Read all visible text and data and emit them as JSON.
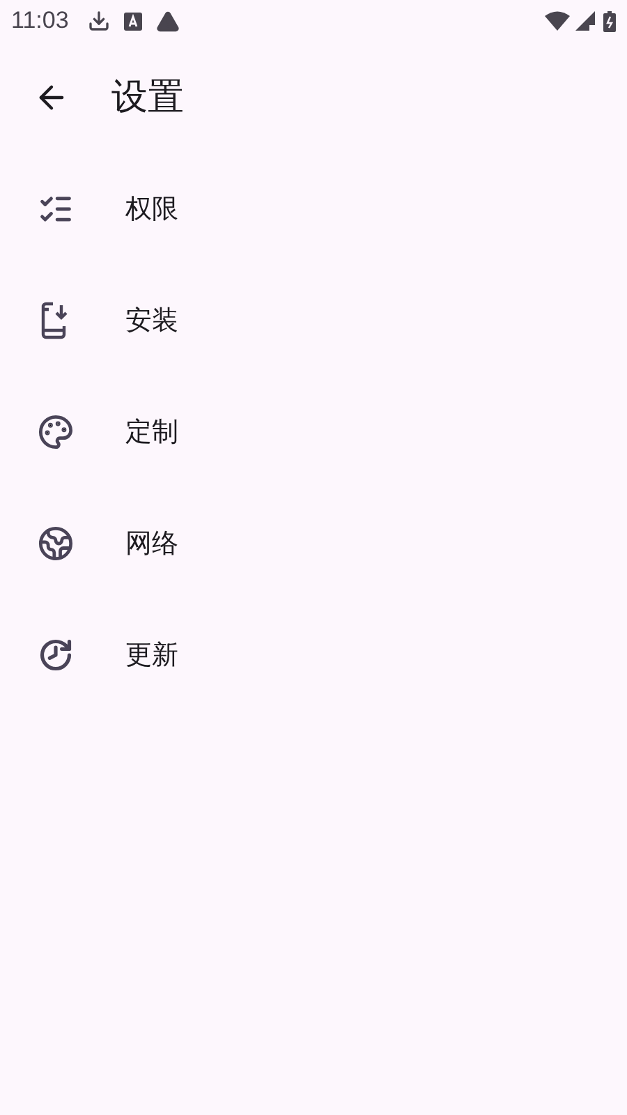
{
  "status_bar": {
    "time": "11:03"
  },
  "app_bar": {
    "title": "设置"
  },
  "menu": [
    {
      "label": "权限"
    },
    {
      "label": "安装"
    },
    {
      "label": "定制"
    },
    {
      "label": "网络"
    },
    {
      "label": "更新"
    }
  ]
}
